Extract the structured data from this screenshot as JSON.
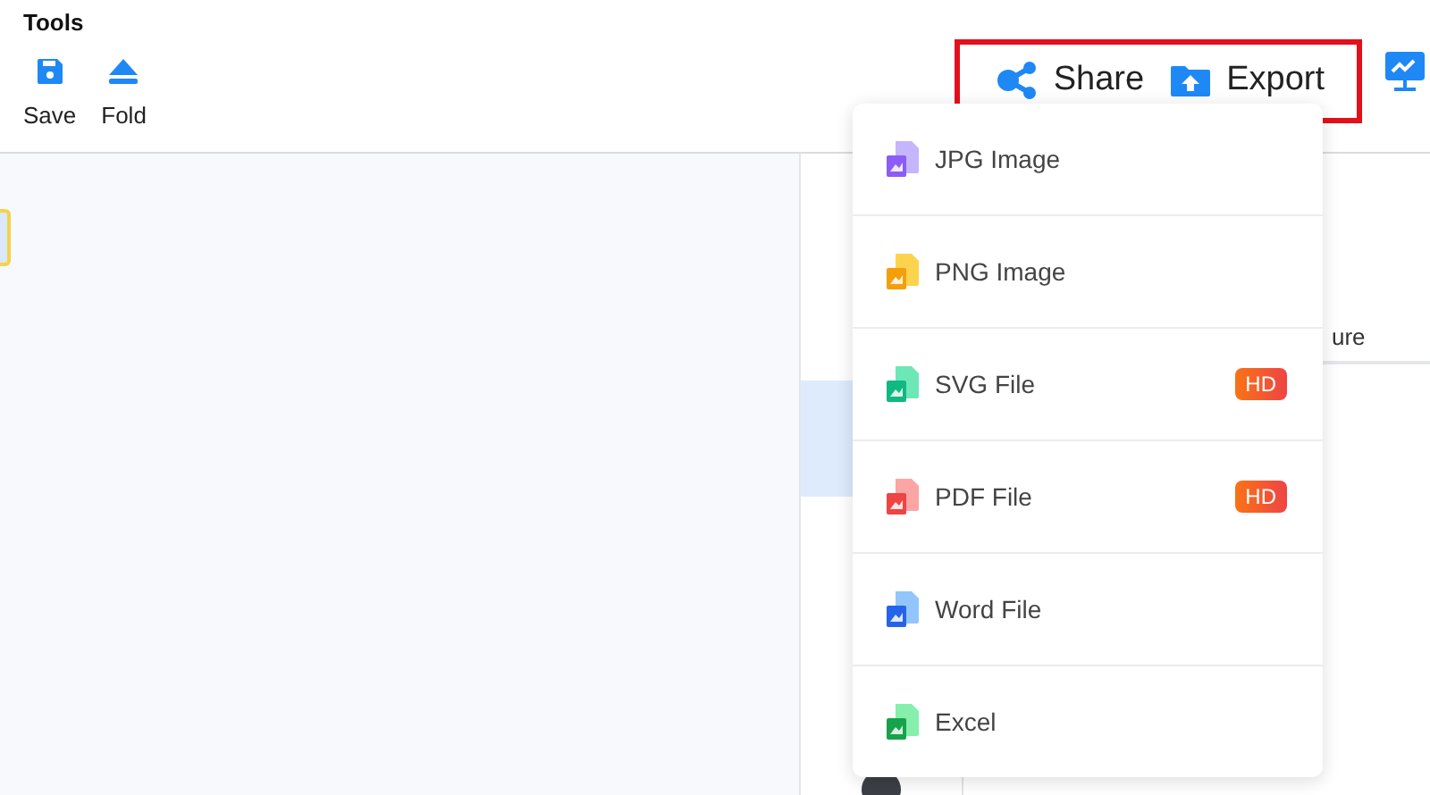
{
  "toolbar": {
    "title": "Tools",
    "buttons": [
      {
        "label": "Save",
        "kind": "save"
      },
      {
        "label": "Fold",
        "kind": "fold"
      }
    ]
  },
  "actions": {
    "highlighted": true,
    "items": [
      {
        "label": "Share",
        "kind": "share"
      },
      {
        "label": "Export",
        "kind": "export"
      }
    ]
  },
  "side_panel": {
    "tab_fragment": "ure"
  },
  "export_menu": {
    "items": [
      {
        "label": "JPG Image",
        "kind": "jpg"
      },
      {
        "label": "PNG Image",
        "kind": "png"
      },
      {
        "label": "SVG File",
        "kind": "svg",
        "badge": "HD"
      },
      {
        "label": "PDF File",
        "kind": "pdf",
        "badge": "HD"
      },
      {
        "label": "Word File",
        "kind": "word"
      },
      {
        "label": "Excel",
        "kind": "excel"
      }
    ]
  }
}
